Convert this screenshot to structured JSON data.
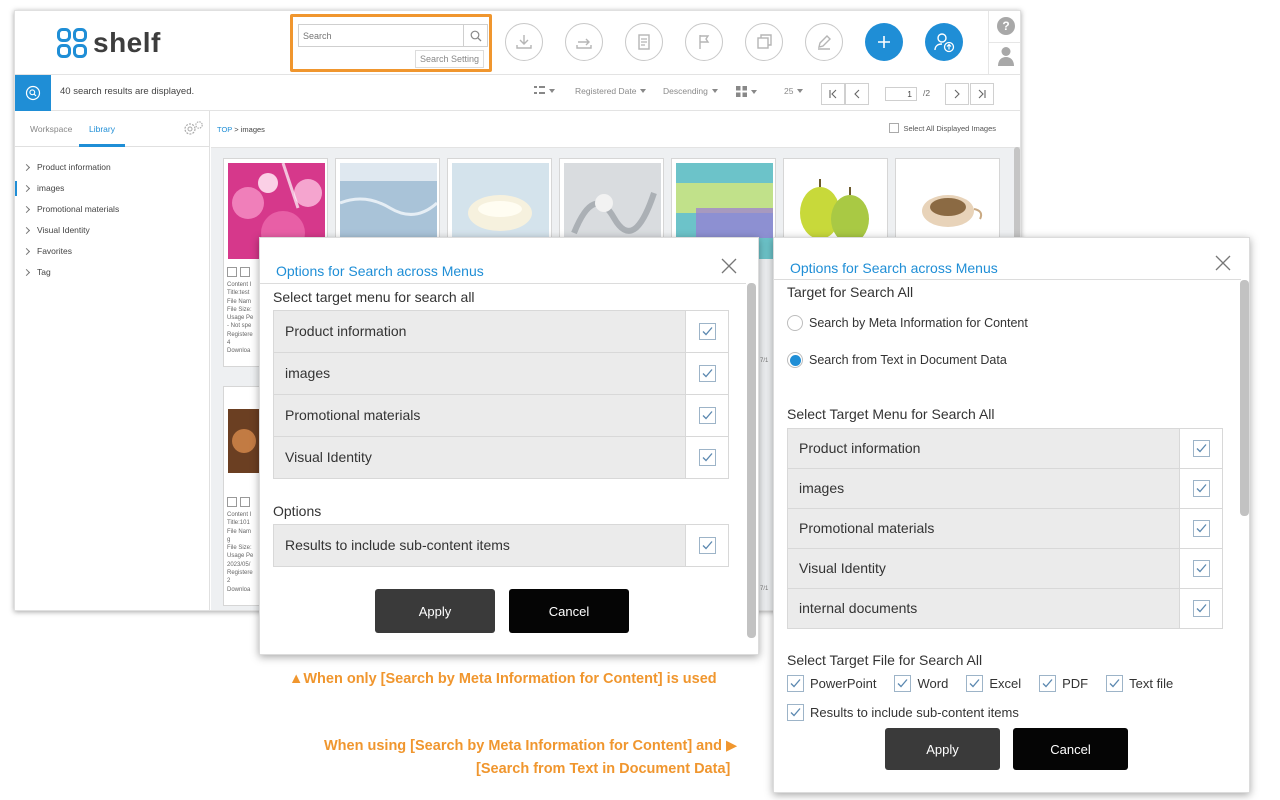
{
  "app": {
    "logo_text": "shelf",
    "search": {
      "placeholder": "Search",
      "setting_label": "Search Setting"
    },
    "help_label": "?",
    "results": {
      "text": "40 search results are displayed.",
      "sort_field": "Registered Date",
      "sort_order": "Descending",
      "per_page": "25",
      "current_page": "1",
      "total_pages": "/2"
    },
    "sidebar": {
      "tabs": [
        "Workspace",
        "Library"
      ],
      "active_tab": "Library",
      "tree": [
        "Product information",
        "images",
        "Promotional materials",
        "Visual Identity",
        "Favorites",
        "Tag"
      ],
      "active_item": "images"
    },
    "breadcrumb": {
      "root": "TOP",
      "separator": ">",
      "current": "images"
    },
    "select_all_label": "Select All Displayed Images",
    "card_meta_1": [
      "Content I",
      "Title:test",
      "File Nam",
      "File Size:",
      "Usage Pe",
      "- Not spe",
      "Registere",
      "4",
      "Downloa"
    ],
    "card_meta_2": [
      "Content I",
      "Title:101",
      "File Nam",
      "g",
      "File Size:",
      "Usage Pe",
      "2023/05/",
      "Registere",
      "2",
      "Downloa"
    ],
    "side_dates": [
      "7/1",
      "7/1"
    ]
  },
  "dialog_left": {
    "title": "Options for Search across Menus",
    "section_menus": "Select target menu for search all",
    "menus": [
      "Product information",
      "images",
      "Promotional materials",
      "Visual Identity"
    ],
    "section_options": "Options",
    "options": [
      "Results to include sub-content items"
    ],
    "apply": "Apply",
    "cancel": "Cancel"
  },
  "dialog_right": {
    "title": "Options for Search across Menus",
    "section_target": "Target for Search All",
    "radio_meta": "Search by Meta Information for Content",
    "radio_text": "Search from Text in Document Data",
    "selected_radio": "Search from Text in Document Data",
    "section_menus": "Select Target Menu for Search All",
    "menus": [
      "Product information",
      "images",
      "Promotional materials",
      "Visual Identity",
      "internal documents"
    ],
    "section_files": "Select Target File for Search All",
    "file_types": [
      "PowerPoint",
      "Word",
      "Excel",
      "PDF",
      "Text file"
    ],
    "include_sub": "Results to include sub-content items",
    "apply": "Apply",
    "cancel": "Cancel"
  },
  "captions": {
    "left": "▲When only [Search by Meta Information for Content] is used",
    "right_line1": "When using [Search by Meta Information for Content] and ▶",
    "right_line2": "[Search from Text in Document Data]"
  },
  "colors": {
    "accent": "#1f8ed6",
    "highlight": "#f0962e",
    "button_dark": "#3a3a3a"
  }
}
